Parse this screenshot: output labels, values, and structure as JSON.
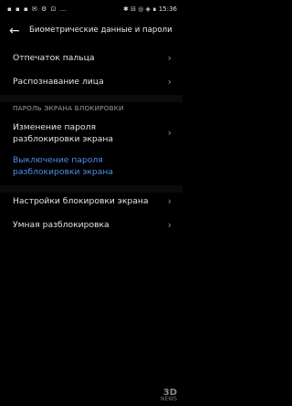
{
  "status_bar": {
    "left_icons": "▪ ▪ ▪ ✉ ⚙ ⊡ …",
    "right_text": "✱ ⊟ ◎ ◈ ∎ 15:36"
  },
  "header": {
    "back_icon": "arrow-left-icon",
    "title": "Биометрические данные и пароли"
  },
  "items_top": [
    {
      "label": "Отпечаток пальца"
    },
    {
      "label": "Распознавание лица"
    }
  ],
  "lock_section": {
    "heading": "ПАРОЛЬ ЭКРАНА БЛОКИРОВКИ",
    "change": {
      "line1": "Изменение пароля",
      "line2": "разблокировки экрана"
    },
    "disable": {
      "line1": "Выключение пароля",
      "line2": "разблокировки экрана",
      "color": "#4d8fe8"
    }
  },
  "items_bottom": [
    {
      "label": "Настройки блокировки экрана"
    },
    {
      "label": "Умная разблокировка"
    }
  ],
  "watermark": {
    "top": "3D",
    "bottom": "NEWS"
  }
}
